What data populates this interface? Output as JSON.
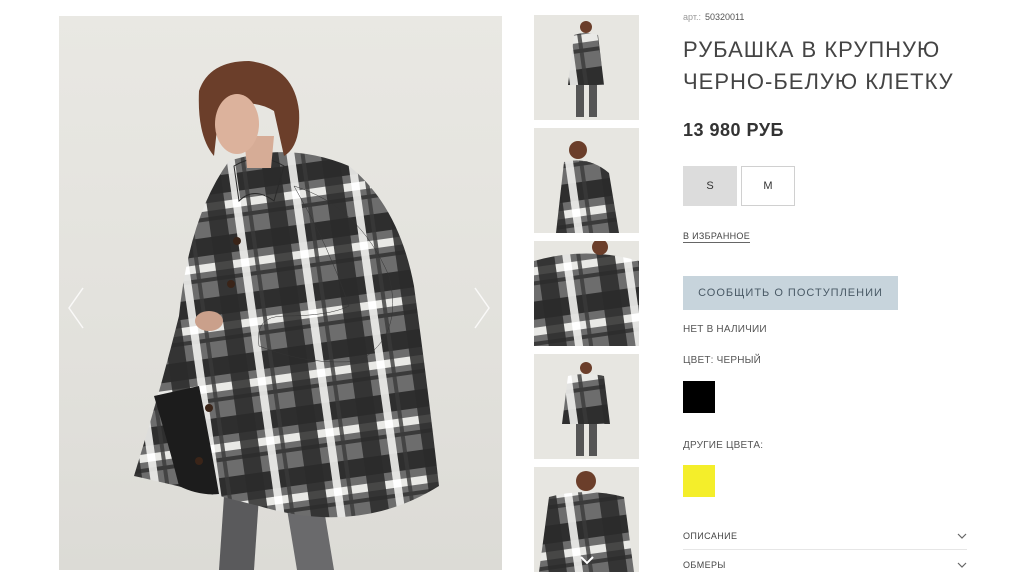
{
  "product": {
    "sku_label": "арт.:",
    "sku": "50320011",
    "title": "РУБАШКА В КРУПНУЮ ЧЕРНО-БЕЛУЮ КЛЕТКУ",
    "price": "13 980 РУБ",
    "sizes": [
      {
        "label": "S",
        "selected": true
      },
      {
        "label": "M",
        "selected": false
      }
    ],
    "favorite_label": "В ИЗБРАННОЕ",
    "notify_label": "СООБЩИТЬ О ПОСТУПЛЕНИИ",
    "stock_status": "НЕТ В НАЛИЧИИ",
    "color_label": "ЦВЕТ: ЧЕРНЫЙ",
    "color_swatch": "#000000",
    "other_colors_label": "ДРУГИЕ ЦВЕТА:",
    "other_colors": [
      "#f4ee2a"
    ],
    "accordion": [
      {
        "label": "ОПИСАНИЕ",
        "icon": "chevron-down-icon"
      },
      {
        "label": "ОБМЕРЫ",
        "icon": "chevron-down-icon"
      }
    ]
  },
  "gallery": {
    "main_image": "model-in-plaid-shirt-jacket",
    "prev_icon": "chevron-left-icon",
    "next_icon": "chevron-right-icon",
    "thumbnails": [
      "full-body-front",
      "side-view",
      "detail-closeup",
      "full-body-belted",
      "front-closeup"
    ],
    "scroll_icon": "chevron-down-icon"
  }
}
